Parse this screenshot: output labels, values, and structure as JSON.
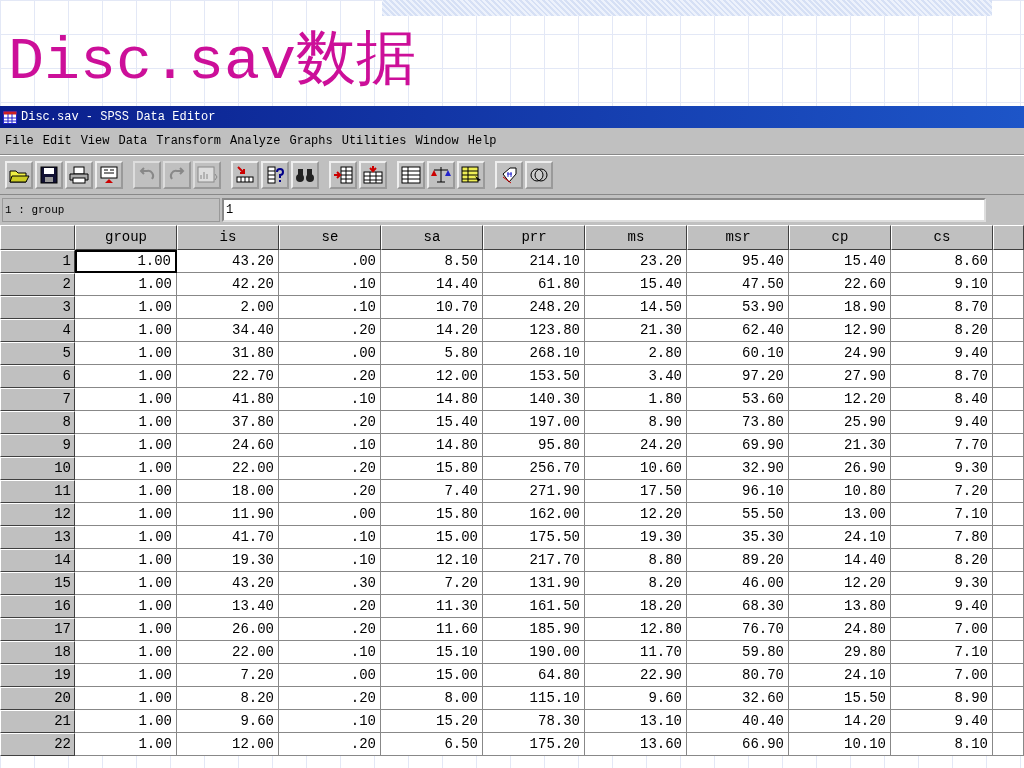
{
  "slide": {
    "title": "Disc.sav数据"
  },
  "window": {
    "title": "Disc.sav - SPSS Data Editor"
  },
  "menu": [
    "File",
    "Edit",
    "View",
    "Data",
    "Transform",
    "Analyze",
    "Graphs",
    "Utilities",
    "Window",
    "Help"
  ],
  "toolbar": [
    {
      "kind": "open",
      "disabled": false
    },
    {
      "kind": "save",
      "disabled": false
    },
    {
      "kind": "print",
      "disabled": false
    },
    {
      "kind": "dialog",
      "disabled": false
    },
    {
      "kind": "undo",
      "disabled": true
    },
    {
      "kind": "redo",
      "disabled": true
    },
    {
      "kind": "chart",
      "disabled": true
    },
    {
      "kind": "goto",
      "disabled": false
    },
    {
      "kind": "variables",
      "disabled": false
    },
    {
      "kind": "find",
      "disabled": false
    },
    {
      "kind": "insertcase",
      "disabled": false
    },
    {
      "kind": "insertvar",
      "disabled": false
    },
    {
      "kind": "split",
      "disabled": false
    },
    {
      "kind": "weight",
      "disabled": false
    },
    {
      "kind": "select",
      "disabled": false
    },
    {
      "kind": "labels",
      "disabled": false
    },
    {
      "kind": "sets",
      "disabled": false
    }
  ],
  "cell_editor": {
    "location": "1 : group",
    "value": "1"
  },
  "table": {
    "columns": [
      "group",
      "is",
      "se",
      "sa",
      "prr",
      "ms",
      "msr",
      "cp",
      "cs"
    ],
    "rows": [
      {
        "number": "1",
        "cells": [
          {
            "text": "1.00",
            "selected": true
          },
          {
            "text": "43.20",
            "selected": false
          },
          {
            "text": ".00",
            "selected": false
          },
          {
            "text": "8.50",
            "selected": false
          },
          {
            "text": "214.10",
            "selected": false
          },
          {
            "text": "23.20",
            "selected": false
          },
          {
            "text": "95.40",
            "selected": false
          },
          {
            "text": "15.40",
            "selected": false
          },
          {
            "text": "8.60",
            "selected": false
          }
        ]
      },
      {
        "number": "2",
        "cells": [
          {
            "text": "1.00",
            "selected": false
          },
          {
            "text": "42.20",
            "selected": false
          },
          {
            "text": ".10",
            "selected": false
          },
          {
            "text": "14.40",
            "selected": false
          },
          {
            "text": "61.80",
            "selected": false
          },
          {
            "text": "15.40",
            "selected": false
          },
          {
            "text": "47.50",
            "selected": false
          },
          {
            "text": "22.60",
            "selected": false
          },
          {
            "text": "9.10",
            "selected": false
          }
        ]
      },
      {
        "number": "3",
        "cells": [
          {
            "text": "1.00",
            "selected": false
          },
          {
            "text": "2.00",
            "selected": false
          },
          {
            "text": ".10",
            "selected": false
          },
          {
            "text": "10.70",
            "selected": false
          },
          {
            "text": "248.20",
            "selected": false
          },
          {
            "text": "14.50",
            "selected": false
          },
          {
            "text": "53.90",
            "selected": false
          },
          {
            "text": "18.90",
            "selected": false
          },
          {
            "text": "8.70",
            "selected": false
          }
        ]
      },
      {
        "number": "4",
        "cells": [
          {
            "text": "1.00",
            "selected": false
          },
          {
            "text": "34.40",
            "selected": false
          },
          {
            "text": ".20",
            "selected": false
          },
          {
            "text": "14.20",
            "selected": false
          },
          {
            "text": "123.80",
            "selected": false
          },
          {
            "text": "21.30",
            "selected": false
          },
          {
            "text": "62.40",
            "selected": false
          },
          {
            "text": "12.90",
            "selected": false
          },
          {
            "text": "8.20",
            "selected": false
          }
        ]
      },
      {
        "number": "5",
        "cells": [
          {
            "text": "1.00",
            "selected": false
          },
          {
            "text": "31.80",
            "selected": false
          },
          {
            "text": ".00",
            "selected": false
          },
          {
            "text": "5.80",
            "selected": false
          },
          {
            "text": "268.10",
            "selected": false
          },
          {
            "text": "2.80",
            "selected": false
          },
          {
            "text": "60.10",
            "selected": false
          },
          {
            "text": "24.90",
            "selected": false
          },
          {
            "text": "9.40",
            "selected": false
          }
        ]
      },
      {
        "number": "6",
        "cells": [
          {
            "text": "1.00",
            "selected": false
          },
          {
            "text": "22.70",
            "selected": false
          },
          {
            "text": ".20",
            "selected": false
          },
          {
            "text": "12.00",
            "selected": false
          },
          {
            "text": "153.50",
            "selected": false
          },
          {
            "text": "3.40",
            "selected": false
          },
          {
            "text": "97.20",
            "selected": false
          },
          {
            "text": "27.90",
            "selected": false
          },
          {
            "text": "8.70",
            "selected": false
          }
        ]
      },
      {
        "number": "7",
        "cells": [
          {
            "text": "1.00",
            "selected": false
          },
          {
            "text": "41.80",
            "selected": false
          },
          {
            "text": ".10",
            "selected": false
          },
          {
            "text": "14.80",
            "selected": false
          },
          {
            "text": "140.30",
            "selected": false
          },
          {
            "text": "1.80",
            "selected": false
          },
          {
            "text": "53.60",
            "selected": false
          },
          {
            "text": "12.20",
            "selected": false
          },
          {
            "text": "8.40",
            "selected": false
          }
        ]
      },
      {
        "number": "8",
        "cells": [
          {
            "text": "1.00",
            "selected": false
          },
          {
            "text": "37.80",
            "selected": false
          },
          {
            "text": ".20",
            "selected": false
          },
          {
            "text": "15.40",
            "selected": false
          },
          {
            "text": "197.00",
            "selected": false
          },
          {
            "text": "8.90",
            "selected": false
          },
          {
            "text": "73.80",
            "selected": false
          },
          {
            "text": "25.90",
            "selected": false
          },
          {
            "text": "9.40",
            "selected": false
          }
        ]
      },
      {
        "number": "9",
        "cells": [
          {
            "text": "1.00",
            "selected": false
          },
          {
            "text": "24.60",
            "selected": false
          },
          {
            "text": ".10",
            "selected": false
          },
          {
            "text": "14.80",
            "selected": false
          },
          {
            "text": "95.80",
            "selected": false
          },
          {
            "text": "24.20",
            "selected": false
          },
          {
            "text": "69.90",
            "selected": false
          },
          {
            "text": "21.30",
            "selected": false
          },
          {
            "text": "7.70",
            "selected": false
          }
        ]
      },
      {
        "number": "10",
        "cells": [
          {
            "text": "1.00",
            "selected": false
          },
          {
            "text": "22.00",
            "selected": false
          },
          {
            "text": ".20",
            "selected": false
          },
          {
            "text": "15.80",
            "selected": false
          },
          {
            "text": "256.70",
            "selected": false
          },
          {
            "text": "10.60",
            "selected": false
          },
          {
            "text": "32.90",
            "selected": false
          },
          {
            "text": "26.90",
            "selected": false
          },
          {
            "text": "9.30",
            "selected": false
          }
        ]
      },
      {
        "number": "11",
        "cells": [
          {
            "text": "1.00",
            "selected": false
          },
          {
            "text": "18.00",
            "selected": false
          },
          {
            "text": ".20",
            "selected": false
          },
          {
            "text": "7.40",
            "selected": false
          },
          {
            "text": "271.90",
            "selected": false
          },
          {
            "text": "17.50",
            "selected": false
          },
          {
            "text": "96.10",
            "selected": false
          },
          {
            "text": "10.80",
            "selected": false
          },
          {
            "text": "7.20",
            "selected": false
          }
        ]
      },
      {
        "number": "12",
        "cells": [
          {
            "text": "1.00",
            "selected": false
          },
          {
            "text": "11.90",
            "selected": false
          },
          {
            "text": ".00",
            "selected": false
          },
          {
            "text": "15.80",
            "selected": false
          },
          {
            "text": "162.00",
            "selected": false
          },
          {
            "text": "12.20",
            "selected": false
          },
          {
            "text": "55.50",
            "selected": false
          },
          {
            "text": "13.00",
            "selected": false
          },
          {
            "text": "7.10",
            "selected": false
          }
        ]
      },
      {
        "number": "13",
        "cells": [
          {
            "text": "1.00",
            "selected": false
          },
          {
            "text": "41.70",
            "selected": false
          },
          {
            "text": ".10",
            "selected": false
          },
          {
            "text": "15.00",
            "selected": false
          },
          {
            "text": "175.50",
            "selected": false
          },
          {
            "text": "19.30",
            "selected": false
          },
          {
            "text": "35.30",
            "selected": false
          },
          {
            "text": "24.10",
            "selected": false
          },
          {
            "text": "7.80",
            "selected": false
          }
        ]
      },
      {
        "number": "14",
        "cells": [
          {
            "text": "1.00",
            "selected": false
          },
          {
            "text": "19.30",
            "selected": false
          },
          {
            "text": ".10",
            "selected": false
          },
          {
            "text": "12.10",
            "selected": false
          },
          {
            "text": "217.70",
            "selected": false
          },
          {
            "text": "8.80",
            "selected": false
          },
          {
            "text": "89.20",
            "selected": false
          },
          {
            "text": "14.40",
            "selected": false
          },
          {
            "text": "8.20",
            "selected": false
          }
        ]
      },
      {
        "number": "15",
        "cells": [
          {
            "text": "1.00",
            "selected": false
          },
          {
            "text": "43.20",
            "selected": false
          },
          {
            "text": ".30",
            "selected": false
          },
          {
            "text": "7.20",
            "selected": false
          },
          {
            "text": "131.90",
            "selected": false
          },
          {
            "text": "8.20",
            "selected": false
          },
          {
            "text": "46.00",
            "selected": false
          },
          {
            "text": "12.20",
            "selected": false
          },
          {
            "text": "9.30",
            "selected": false
          }
        ]
      },
      {
        "number": "16",
        "cells": [
          {
            "text": "1.00",
            "selected": false
          },
          {
            "text": "13.40",
            "selected": false
          },
          {
            "text": ".20",
            "selected": false
          },
          {
            "text": "11.30",
            "selected": false
          },
          {
            "text": "161.50",
            "selected": false
          },
          {
            "text": "18.20",
            "selected": false
          },
          {
            "text": "68.30",
            "selected": false
          },
          {
            "text": "13.80",
            "selected": false
          },
          {
            "text": "9.40",
            "selected": false
          }
        ]
      },
      {
        "number": "17",
        "cells": [
          {
            "text": "1.00",
            "selected": false
          },
          {
            "text": "26.00",
            "selected": false
          },
          {
            "text": ".20",
            "selected": false
          },
          {
            "text": "11.60",
            "selected": false
          },
          {
            "text": "185.90",
            "selected": false
          },
          {
            "text": "12.80",
            "selected": false
          },
          {
            "text": "76.70",
            "selected": false
          },
          {
            "text": "24.80",
            "selected": false
          },
          {
            "text": "7.00",
            "selected": false
          }
        ]
      },
      {
        "number": "18",
        "cells": [
          {
            "text": "1.00",
            "selected": false
          },
          {
            "text": "22.00",
            "selected": false
          },
          {
            "text": ".10",
            "selected": false
          },
          {
            "text": "15.10",
            "selected": false
          },
          {
            "text": "190.00",
            "selected": false
          },
          {
            "text": "11.70",
            "selected": false
          },
          {
            "text": "59.80",
            "selected": false
          },
          {
            "text": "29.80",
            "selected": false
          },
          {
            "text": "7.10",
            "selected": false
          }
        ]
      },
      {
        "number": "19",
        "cells": [
          {
            "text": "1.00",
            "selected": false
          },
          {
            "text": "7.20",
            "selected": false
          },
          {
            "text": ".00",
            "selected": false
          },
          {
            "text": "15.00",
            "selected": false
          },
          {
            "text": "64.80",
            "selected": false
          },
          {
            "text": "22.90",
            "selected": false
          },
          {
            "text": "80.70",
            "selected": false
          },
          {
            "text": "24.10",
            "selected": false
          },
          {
            "text": "7.00",
            "selected": false
          }
        ]
      },
      {
        "number": "20",
        "cells": [
          {
            "text": "1.00",
            "selected": false
          },
          {
            "text": "8.20",
            "selected": false
          },
          {
            "text": ".20",
            "selected": false
          },
          {
            "text": "8.00",
            "selected": false
          },
          {
            "text": "115.10",
            "selected": false
          },
          {
            "text": "9.60",
            "selected": false
          },
          {
            "text": "32.60",
            "selected": false
          },
          {
            "text": "15.50",
            "selected": false
          },
          {
            "text": "8.90",
            "selected": false
          }
        ]
      },
      {
        "number": "21",
        "cells": [
          {
            "text": "1.00",
            "selected": false
          },
          {
            "text": "9.60",
            "selected": false
          },
          {
            "text": ".10",
            "selected": false
          },
          {
            "text": "15.20",
            "selected": false
          },
          {
            "text": "78.30",
            "selected": false
          },
          {
            "text": "13.10",
            "selected": false
          },
          {
            "text": "40.40",
            "selected": false
          },
          {
            "text": "14.20",
            "selected": false
          },
          {
            "text": "9.40",
            "selected": false
          }
        ]
      },
      {
        "number": "22",
        "cells": [
          {
            "text": "1.00",
            "selected": false
          },
          {
            "text": "12.00",
            "selected": false
          },
          {
            "text": ".20",
            "selected": false
          },
          {
            "text": "6.50",
            "selected": false
          },
          {
            "text": "175.20",
            "selected": false
          },
          {
            "text": "13.60",
            "selected": false
          },
          {
            "text": "66.90",
            "selected": false
          },
          {
            "text": "10.10",
            "selected": false
          },
          {
            "text": "8.10",
            "selected": false
          }
        ]
      }
    ]
  }
}
